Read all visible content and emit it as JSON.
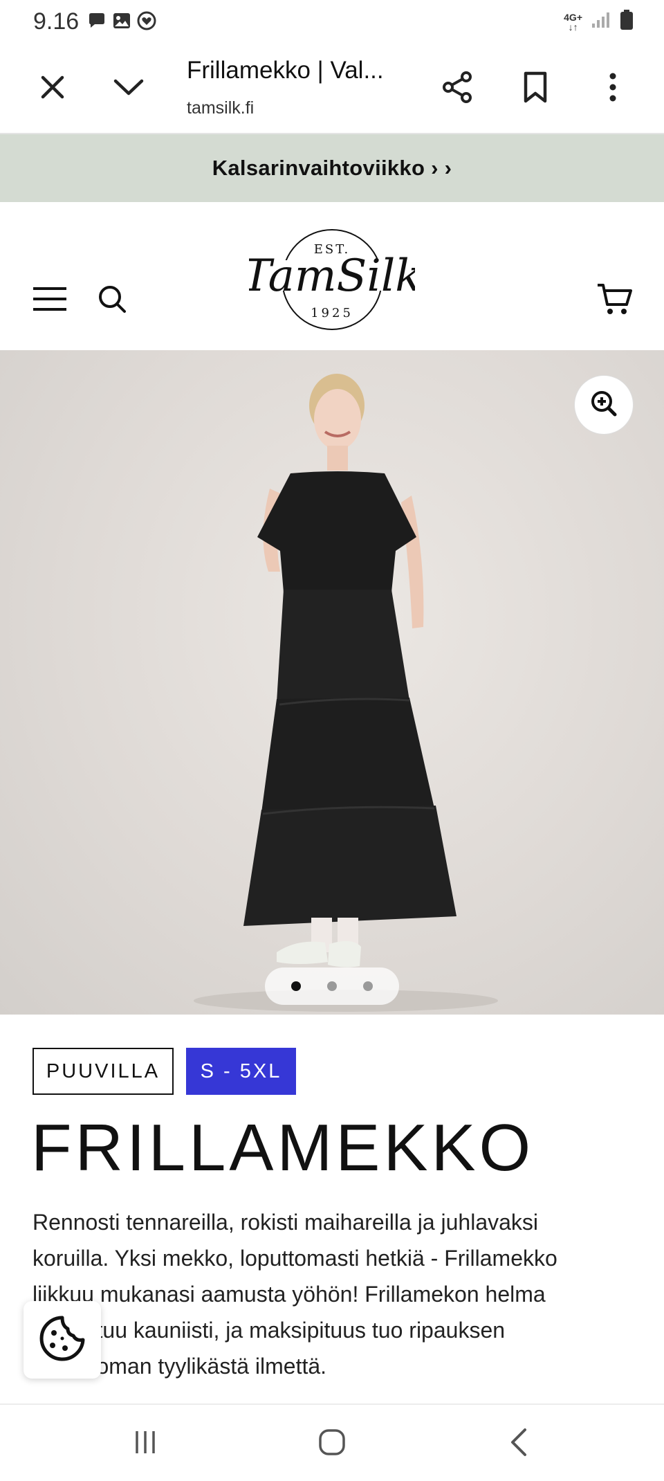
{
  "status_bar": {
    "time": "9.16",
    "network": "4G+",
    "icons": [
      "chat-bubble-icon",
      "image-icon",
      "heart-badge-icon",
      "signal-icon",
      "battery-icon"
    ]
  },
  "browser": {
    "title": "Frillamekko | Val...",
    "url": "tamsilk.fi",
    "icons": [
      "close-icon",
      "chevron-down-icon",
      "share-icon",
      "bookmark-icon",
      "more-vertical-icon"
    ]
  },
  "promo": {
    "text": "Kalsarinvaihtoviikko › ›",
    "background": "#d4dbd2"
  },
  "header": {
    "logo": {
      "est": "EST.",
      "brand": "TamSilk",
      "year": "1925"
    },
    "icons": [
      "menu-icon",
      "search-icon",
      "cart-icon"
    ]
  },
  "gallery": {
    "image_alt": "Woman wearing a black tiered maxi dress with white sneakers",
    "slide_count": 3,
    "active_slide": 1
  },
  "product": {
    "badge_material": "PUUVILLA",
    "badge_sizes": "S - 5XL",
    "badge_sizes_color": "#3637d6",
    "title": "FRILLAMEKKO",
    "description_lines": [
      "Rennosti tennareilla, rokisti maihareilla ja juhlavaksi",
      "koruilla. Yksi mekko, loputtomasti hetkiä - Frillamekko",
      "liikkuu mukanasi aamusta yöhön! Frillamekon helma",
      "laskeutuu kauniisti, ja maksipituus tuo ripauksen",
      "vaivattoman tyylikästä ilmettä."
    ]
  },
  "cookie_button": {
    "icon": "cookie-icon"
  },
  "nav_bar": {
    "icons": [
      "recent-apps-icon",
      "home-icon",
      "back-icon"
    ]
  }
}
